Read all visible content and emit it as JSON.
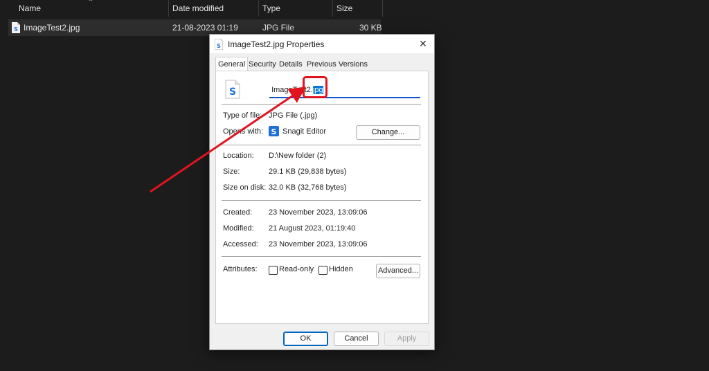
{
  "explorer": {
    "columns": [
      "Name",
      "Date modified",
      "Type",
      "Size"
    ],
    "row": {
      "name": "ImageTest2.jpg",
      "date_modified": "21-08-2023 01:19",
      "type": "JPG File",
      "size": "30 KB"
    }
  },
  "dialog": {
    "title": "ImageTest2.jpg Properties",
    "tabs": [
      "General",
      "Security",
      "Details",
      "Previous Versions"
    ],
    "file_name": {
      "base": "ImageTest2.",
      "ext": "jpg"
    },
    "type_of_file": {
      "label": "Type of file:",
      "value": "JPG File (.jpg)"
    },
    "opens_with": {
      "label": "Opens with:",
      "app": "Snagit Editor",
      "change_button": "Change..."
    },
    "location": {
      "label": "Location:",
      "value": "D:\\New folder (2)"
    },
    "size": {
      "label": "Size:",
      "value": "29.1 KB (29,838 bytes)"
    },
    "size_on_disk": {
      "label": "Size on disk:",
      "value": "32.0 KB (32,768 bytes)"
    },
    "created": {
      "label": "Created:",
      "value": "23 November 2023, 13:09:06"
    },
    "modified": {
      "label": "Modified:",
      "value": "21 August 2023, 01:19:40"
    },
    "accessed": {
      "label": "Accessed:",
      "value": "23 November 2023, 13:09:06"
    },
    "attributes": {
      "label": "Attributes:",
      "read_only": "Read-only",
      "hidden": "Hidden",
      "advanced_button": "Advanced..."
    },
    "buttons": {
      "ok": "OK",
      "cancel": "Cancel",
      "apply": "Apply"
    }
  },
  "colors": {
    "annotation": "#e0141e",
    "selection": "#0078d7"
  },
  "icons": {
    "file": "snagit-file-icon",
    "app": "snagit-app-icon",
    "close": "close-icon"
  }
}
